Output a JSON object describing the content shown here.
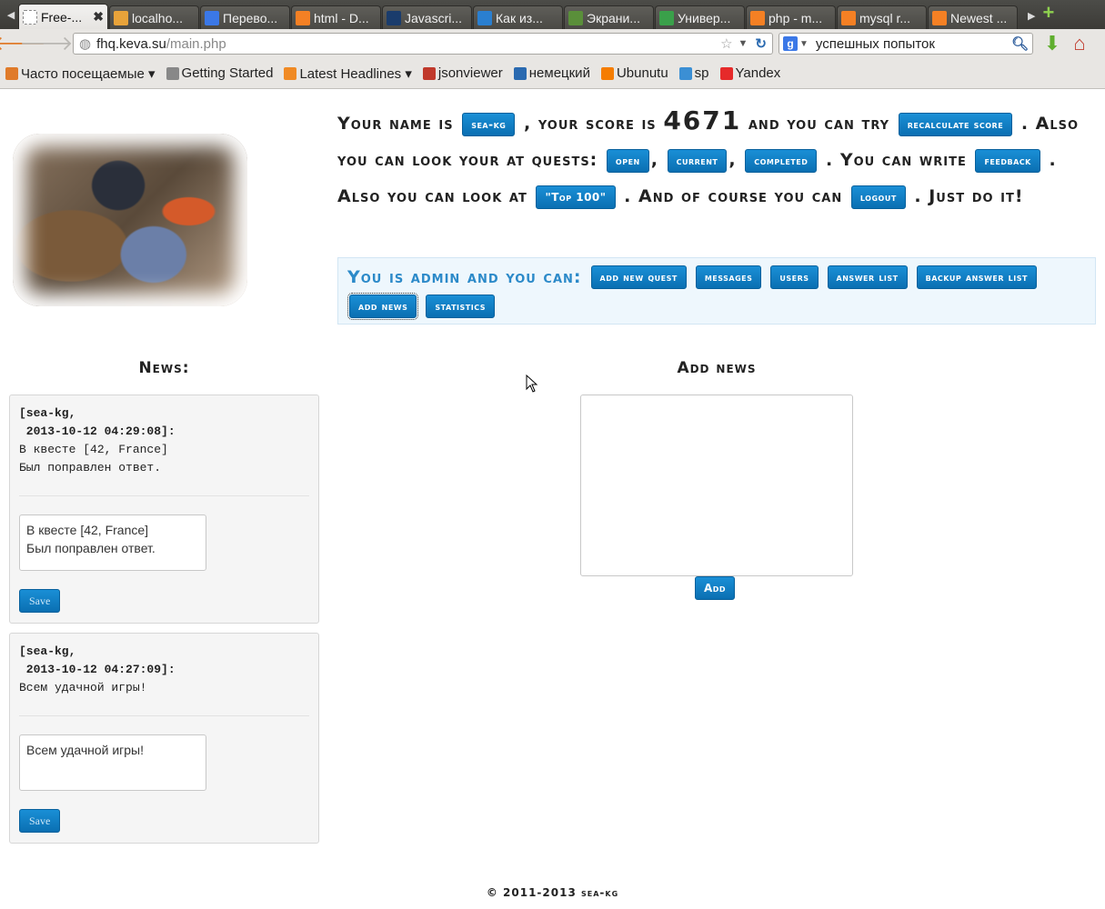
{
  "browser": {
    "tabs": [
      {
        "title": "Free-...",
        "active": true,
        "color": "#ffffff"
      },
      {
        "title": "localho...",
        "color": "#e8a33a"
      },
      {
        "title": "Перево...",
        "color": "#3b78e7"
      },
      {
        "title": "html - D...",
        "color": "#f48024"
      },
      {
        "title": "Javascri...",
        "color": "#1a3c6c"
      },
      {
        "title": "Как из...",
        "color": "#2a7fd0"
      },
      {
        "title": "Экрани...",
        "color": "#5a8f3a"
      },
      {
        "title": "Универ...",
        "color": "#3aa04a"
      },
      {
        "title": "php - m...",
        "color": "#f48024"
      },
      {
        "title": "mysql r...",
        "color": "#f48024"
      },
      {
        "title": "Newest ...",
        "color": "#f48024"
      }
    ],
    "url_host": "fhq.keva.su",
    "url_path": "/main.php",
    "search_query": "успешных попыток",
    "bookmarks": [
      {
        "label": "Часто посещаемые ▾",
        "color": "#e07b2a"
      },
      {
        "label": "Getting Started",
        "color": "#888888"
      },
      {
        "label": "Latest Headlines ▾",
        "color": "#f08a24"
      },
      {
        "label": "jsonviewer",
        "color": "#c0392b"
      },
      {
        "label": "немецкий",
        "color": "#2a6ab0"
      },
      {
        "label": "Ubunutu",
        "color": "#f57d00"
      },
      {
        "label": "sp",
        "color": "#3b8fd4"
      },
      {
        "label": "Yandex",
        "color": "#e62a2a"
      }
    ]
  },
  "intro": {
    "t1": "Your name is",
    "name": "sea-kg",
    "t2": ", your score is",
    "score": "4671",
    "t3": "and you can try",
    "recalc": "recalculate score",
    "t4": ". Also you can look your at quests:",
    "open": "open",
    "comma1": ",",
    "current": "current",
    "comma2": ",",
    "completed": "completed",
    "t5": ". You can write",
    "feedback": "feedback",
    "t6": ". Also you can look at",
    "top100": "\"Top 100\"",
    "t7": ". And of course you can",
    "logout": "logout",
    "t8": ". Just do it!"
  },
  "admin": {
    "lead": "You is admin and you can:",
    "buttons": [
      "add new quest",
      "messages",
      "users",
      "answer list",
      "backup answer list",
      "add news",
      "statistics"
    ]
  },
  "news": {
    "title": "News:",
    "items": [
      {
        "author": "[sea-kg,",
        "date": " 2013-10-12 04:29:08]:",
        "body": "В квесте [42, France]\nБыл поправлен ответ.",
        "edit_value": "В квесте [42, France]\nБыл поправлен ответ.",
        "save": "Save"
      },
      {
        "author": "[sea-kg,",
        "date": " 2013-10-12 04:27:09]:",
        "body": "Всем удачной игры!",
        "edit_value": "Всем удачной игры!",
        "save": "Save"
      }
    ]
  },
  "add_news": {
    "title": "Add news",
    "button": "Add"
  },
  "footer": "© 2011-2013 sea-kg"
}
